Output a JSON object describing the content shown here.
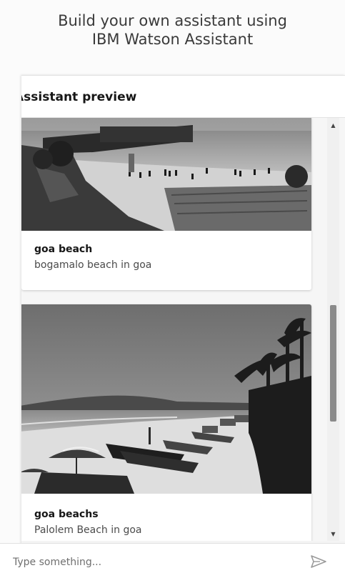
{
  "heading": {
    "line1": "Build your own assistant using",
    "line2": "IBM Watson Assistant"
  },
  "preview": {
    "title": "Assistant preview"
  },
  "cards": [
    {
      "title": "goa beach",
      "description": "bogamalo beach in goa",
      "image": "beach-fort-photo"
    },
    {
      "title": "goa beachs",
      "description": "Palolem Beach in goa",
      "image": "palm-beach-boats-photo"
    }
  ],
  "input": {
    "placeholder": "Type something..."
  },
  "icons": {
    "send": "send-icon",
    "scroll_up": "chevron-up-icon",
    "scroll_down": "chevron-down-icon"
  }
}
